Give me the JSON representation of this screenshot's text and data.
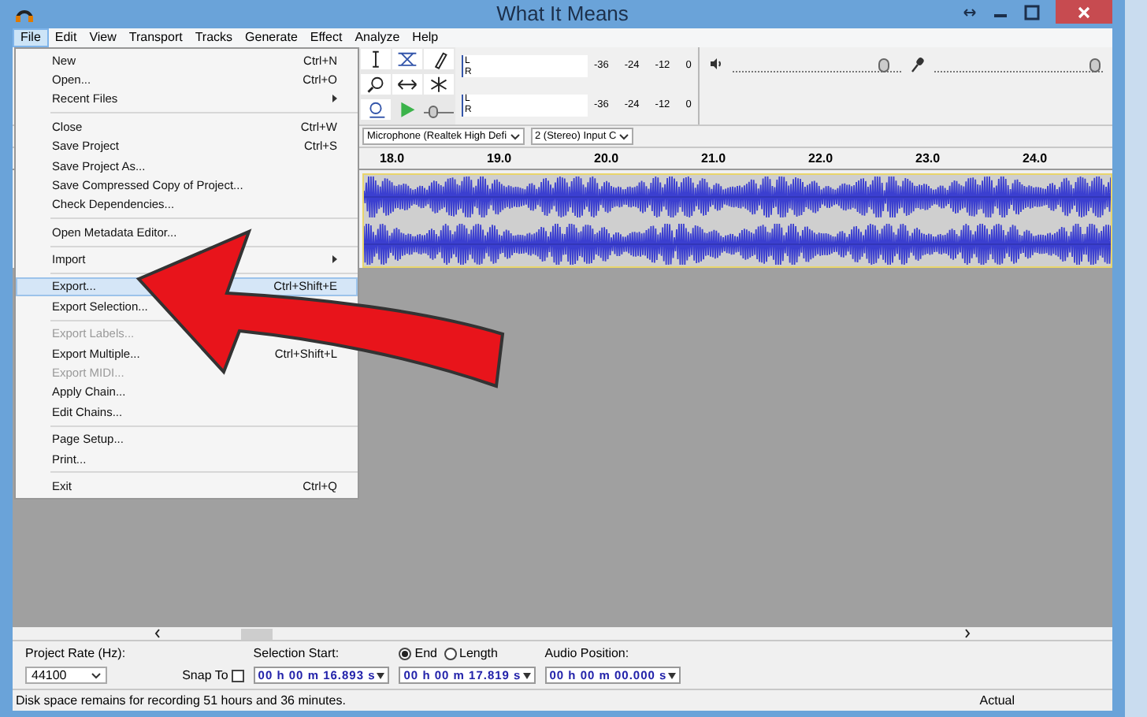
{
  "window": {
    "title": "What It Means"
  },
  "menu_bar": [
    {
      "label": "File",
      "selected": true
    },
    {
      "label": "Edit",
      "selected": false
    },
    {
      "label": "View",
      "selected": false
    },
    {
      "label": "Transport",
      "selected": false
    },
    {
      "label": "Tracks",
      "selected": false
    },
    {
      "label": "Generate",
      "selected": false
    },
    {
      "label": "Effect",
      "selected": false
    },
    {
      "label": "Analyze",
      "selected": false
    },
    {
      "label": "Help",
      "selected": false
    }
  ],
  "file_menu": [
    {
      "kind": "item",
      "label": "New",
      "shortcut": "Ctrl+N",
      "disabled": false,
      "selected": false
    },
    {
      "kind": "item",
      "label": "Open...",
      "shortcut": "Ctrl+O",
      "disabled": false,
      "selected": false
    },
    {
      "kind": "submenu",
      "label": "Recent Files",
      "disabled": false,
      "selected": false
    },
    {
      "kind": "separator"
    },
    {
      "kind": "item",
      "label": "Close",
      "shortcut": "Ctrl+W",
      "disabled": false,
      "selected": false
    },
    {
      "kind": "item",
      "label": "Save Project",
      "shortcut": "Ctrl+S",
      "disabled": false,
      "selected": false
    },
    {
      "kind": "item",
      "label": "Save Project As...",
      "disabled": false,
      "selected": false
    },
    {
      "kind": "item",
      "label": "Save Compressed Copy of Project...",
      "disabled": false,
      "selected": false
    },
    {
      "kind": "item",
      "label": "Check Dependencies...",
      "disabled": false,
      "selected": false
    },
    {
      "kind": "separator"
    },
    {
      "kind": "item",
      "label": "Open Metadata Editor...",
      "disabled": false,
      "selected": false
    },
    {
      "kind": "separator"
    },
    {
      "kind": "submenu",
      "label": "Import",
      "disabled": false,
      "selected": false
    },
    {
      "kind": "separator"
    },
    {
      "kind": "item",
      "label": "Export...",
      "shortcut": "Ctrl+Shift+E",
      "disabled": false,
      "selected": true
    },
    {
      "kind": "item",
      "label": "Export Selection...",
      "disabled": false,
      "selected": false
    },
    {
      "kind": "separator"
    },
    {
      "kind": "item",
      "label": "Export Labels...",
      "disabled": true,
      "selected": false
    },
    {
      "kind": "item",
      "label": "Export Multiple...",
      "shortcut": "Ctrl+Shift+L",
      "disabled": false,
      "selected": false
    },
    {
      "kind": "item",
      "label": "Export MIDI...",
      "disabled": true,
      "selected": false
    },
    {
      "kind": "item",
      "label": "Apply Chain...",
      "disabled": false,
      "selected": false
    },
    {
      "kind": "item",
      "label": "Edit Chains...",
      "disabled": false,
      "selected": false
    },
    {
      "kind": "separator"
    },
    {
      "kind": "item",
      "label": "Page Setup...",
      "disabled": false,
      "selected": false
    },
    {
      "kind": "item",
      "label": "Print...",
      "disabled": false,
      "selected": false
    },
    {
      "kind": "separator"
    },
    {
      "kind": "item",
      "label": "Exit",
      "shortcut": "Ctrl+Q",
      "disabled": false,
      "selected": false
    }
  ],
  "meters": [
    {
      "channels": [
        "L",
        "R"
      ],
      "scale": [
        "-36",
        "-24",
        "-12",
        "0"
      ]
    },
    {
      "channels": [
        "L",
        "R"
      ],
      "scale": [
        "-36",
        "-24",
        "-12",
        "0"
      ]
    }
  ],
  "mixer": [
    {
      "level": 0.9
    },
    {
      "level": 0.95
    }
  ],
  "play_speed": {
    "level": 0.3
  },
  "devices": [
    "Microphone (Realtek High Defi",
    "2 (Stereo) Input C"
  ],
  "ruler": [
    "18.0",
    "19.0",
    "20.0",
    "21.0",
    "22.0",
    "23.0",
    "24.0"
  ],
  "selection_toolbar": {
    "project_rate_label": "Project Rate (Hz):",
    "project_rate": "44100",
    "snap_to_label": "Snap To",
    "snap_to_checked": false,
    "selection_start_label": "Selection Start:",
    "end_options": [
      {
        "label": "End",
        "selected": true
      },
      {
        "label": "Length",
        "selected": false
      }
    ],
    "selection_start": "00 h 00 m 16.893 s",
    "selection_end": "00 h 00 m 17.819 s",
    "audio_position_label": "Audio Position:",
    "audio_position": "00 h 00 m 00.000 s"
  },
  "status_bar": {
    "message": "Disk space remains for recording 51 hours and 36 minutes.",
    "rate": "Actual"
  }
}
